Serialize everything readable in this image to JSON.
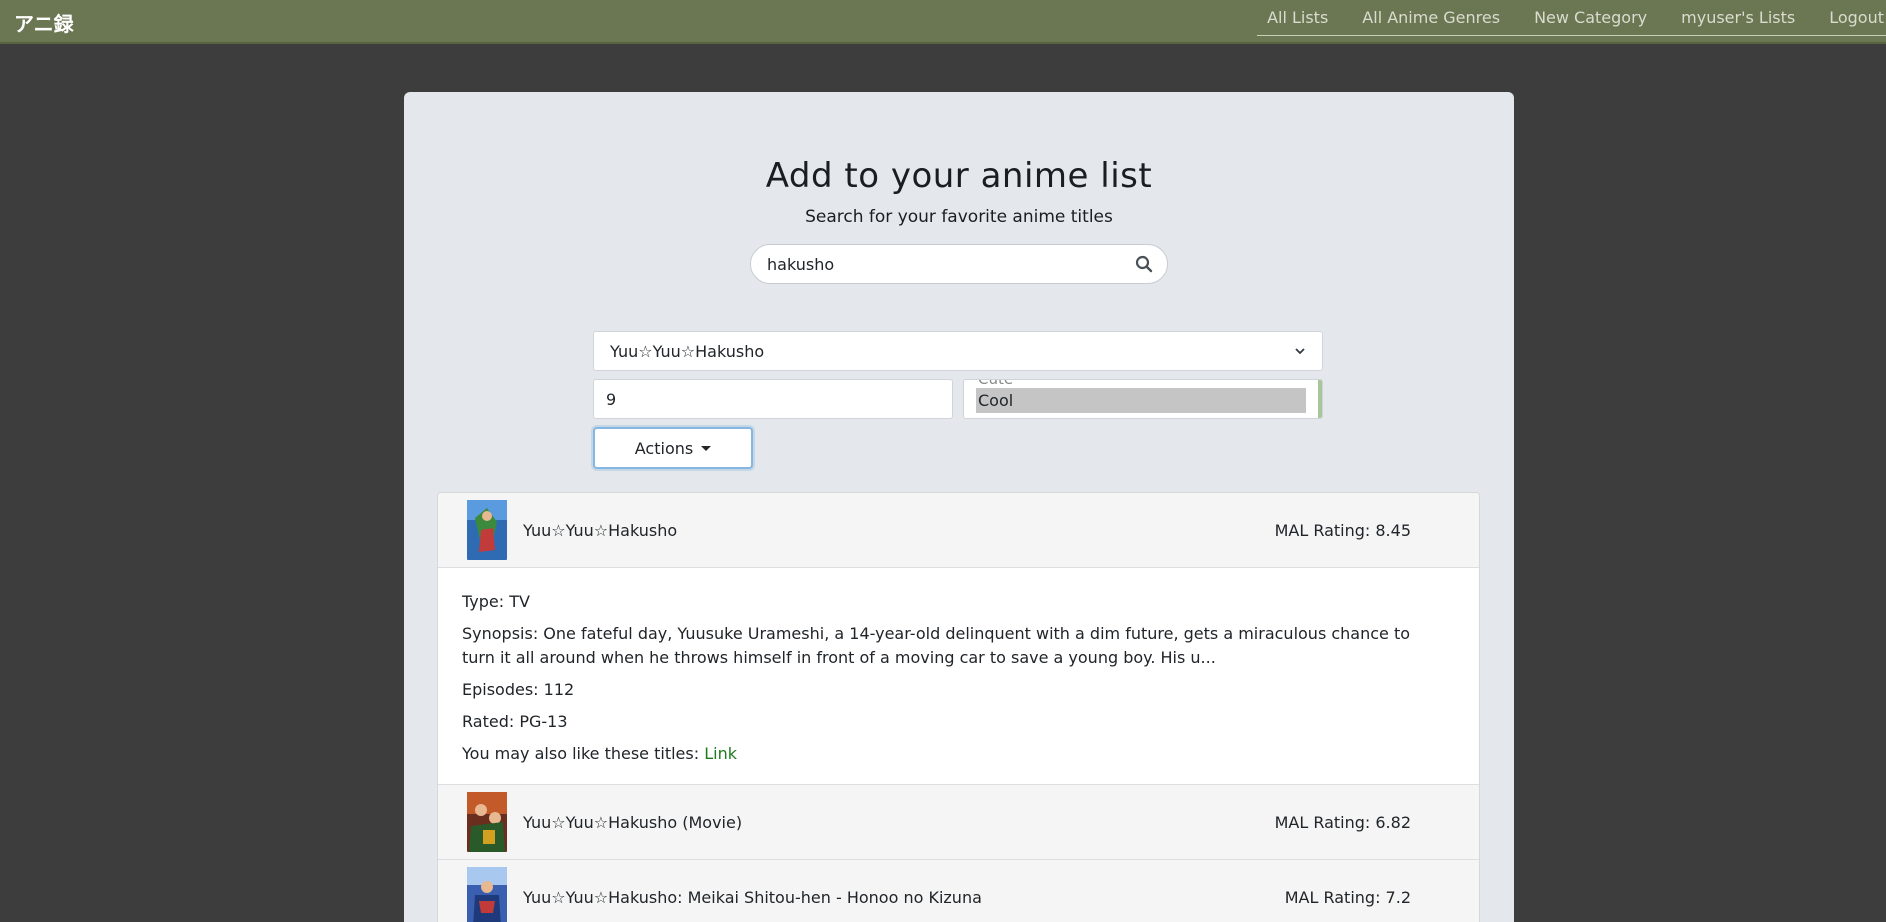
{
  "navbar": {
    "brand": "アニ録",
    "links": [
      "All Lists",
      "All Anime Genres",
      "New Category",
      "myuser's Lists",
      "Logout"
    ]
  },
  "page": {
    "title": "Add to your anime list",
    "subtitle": "Search for your favorite anime titles"
  },
  "search": {
    "value": "hakusho"
  },
  "form": {
    "selected_title": "Yuu☆Yuu☆Hakusho",
    "score_value": "9",
    "category_peek": "Cute",
    "category_selected": "Cool",
    "actions_label": "Actions"
  },
  "results": [
    {
      "title": "Yuu☆Yuu☆Hakusho",
      "rating": "MAL Rating: 8.45",
      "expanded": true,
      "type": "Type: TV",
      "synopsis": "Synopsis: One fateful day, Yuusuke Urameshi, a 14-year-old delinquent with a dim future, gets a miraculous chance to turn it all around when he throws himself in front of a moving car to save a young boy. His u...",
      "episodes": "Episodes: 112",
      "rated": "Rated: PG-13",
      "also_like": "You may also like these titles:",
      "link_label": "Link"
    },
    {
      "title": "Yuu☆Yuu☆Hakusho (Movie)",
      "rating": "MAL Rating: 6.82"
    },
    {
      "title": "Yuu☆Yuu☆Hakusho: Meikai Shitou-hen - Honoo no Kizuna",
      "rating": "MAL Rating: 7.2"
    }
  ],
  "colors": {
    "navbar": "#6b7652",
    "background": "#3d3d3d",
    "panel": "#e4e8ec",
    "link": "#1f7a1f"
  }
}
